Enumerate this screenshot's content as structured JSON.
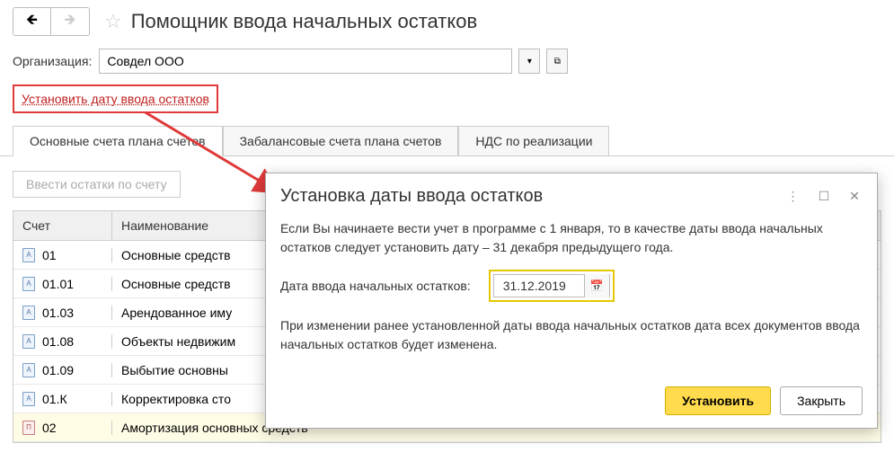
{
  "header": {
    "title": "Помощник ввода начальных остатков"
  },
  "org": {
    "label": "Организация:",
    "value": "Совдел ООО"
  },
  "set_date_link": "Установить дату ввода остатков",
  "tabs": {
    "t1": "Основные счета плана счетов",
    "t2": "Забалансовые счета плана счетов",
    "t3": "НДС по реализации"
  },
  "enter_balance": "Ввести остатки по счету",
  "table": {
    "head_account": "Счет",
    "head_name": "Наименование",
    "rows": [
      {
        "acc": "01",
        "name": "Основные средств",
        "red": false,
        "hl": false
      },
      {
        "acc": "01.01",
        "name": "Основные средств",
        "red": false,
        "hl": false
      },
      {
        "acc": "01.03",
        "name": "Арендованное иму",
        "red": false,
        "hl": false
      },
      {
        "acc": "01.08",
        "name": "Объекты недвижим",
        "red": false,
        "hl": false
      },
      {
        "acc": "01.09",
        "name": "Выбытие основны",
        "red": false,
        "hl": false
      },
      {
        "acc": "01.К",
        "name": "Корректировка сто",
        "red": false,
        "hl": false
      },
      {
        "acc": "02",
        "name": "Амортизация основных средств",
        "red": true,
        "hl": true
      }
    ]
  },
  "dialog": {
    "title": "Установка даты ввода остатков",
    "p1": "Если Вы начинаете вести учет в программе с 1 января, то в качестве даты ввода начальных остатков следует установить дату – 31 декабря предыдущего года.",
    "date_label": "Дата ввода начальных остатков:",
    "date_value": "31.12.2019",
    "p2": "При изменении ранее установленной даты ввода начальных остатков дата всех документов ввода начальных остатков будет изменена.",
    "set_btn": "Установить",
    "close_btn": "Закрыть"
  }
}
